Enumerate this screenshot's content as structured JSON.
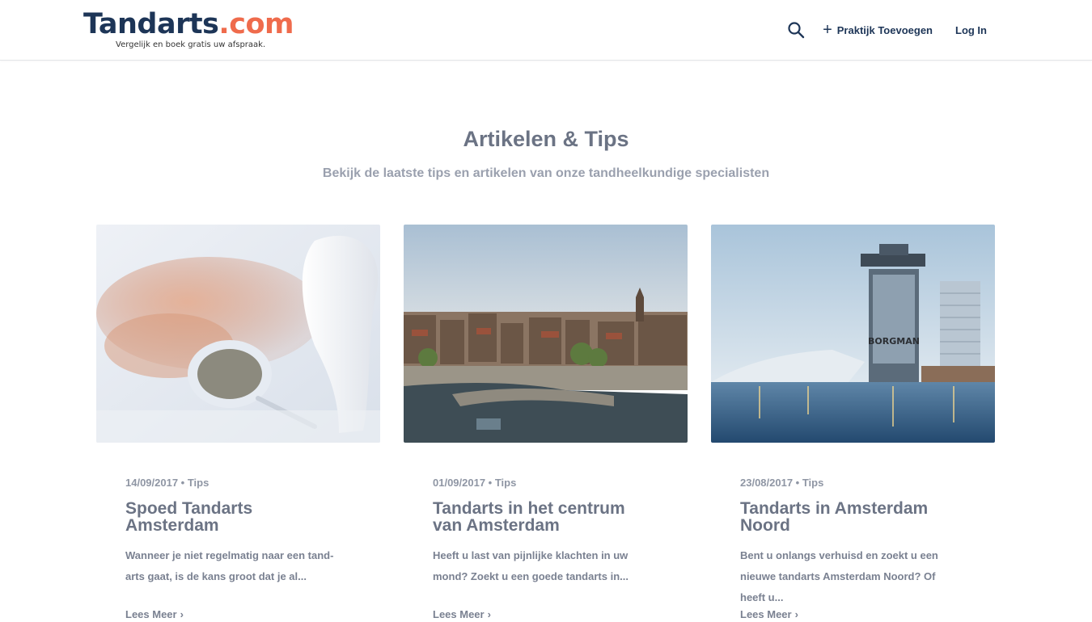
{
  "header": {
    "logo_main": "Tandarts",
    "logo_accent": ".com",
    "tagline": "Vergelijk en boek gratis uw afspraak.",
    "add_practice": "Praktijk Toevoegen",
    "login": "Log In",
    "search_icon": "search-icon",
    "add_icon": "plus-icon"
  },
  "section": {
    "title": "Artikelen & Tips",
    "subtitle": "Bekijk de laatste tips en artikelen van onze tandheelkundige specialisten"
  },
  "articles": [
    {
      "meta": "14/09/2017 • Tips",
      "title_line1": "Spoed Tandarts",
      "title_line2": "Amsterdam",
      "excerpt_line1": "Wanneer je niet regelmatig naar een tand-",
      "excerpt_line2": "arts gaat, is de kans groot dat je al...",
      "excerpt_line3": "",
      "more": "Lees Meer"
    },
    {
      "meta": "01/09/2017 • Tips",
      "title_line1": "Tandarts in het centrum",
      "title_line2": "van Amsterdam",
      "excerpt_line1": "Heeft u last van pijnlijke klachten in uw",
      "excerpt_line2": "mond? Zoekt u een goede tandarts in...",
      "excerpt_line3": "",
      "more": "Lees Meer"
    },
    {
      "meta": "23/08/2017 • Tips",
      "title_line1": "Tandarts in Amsterdam",
      "title_line2": "Noord",
      "excerpt_line1": "Bent u onlangs verhuisd en zoekt u een",
      "excerpt_line2": "nieuwe tandarts Amsterdam Noord? Of",
      "excerpt_line3": "heeft u...",
      "more": "Lees Meer"
    }
  ],
  "image_sign_text": "BORGMAN",
  "colors": {
    "brand_dark": "#1d3557",
    "brand_accent": "#ef6b4c",
    "text": "#6b7384"
  }
}
